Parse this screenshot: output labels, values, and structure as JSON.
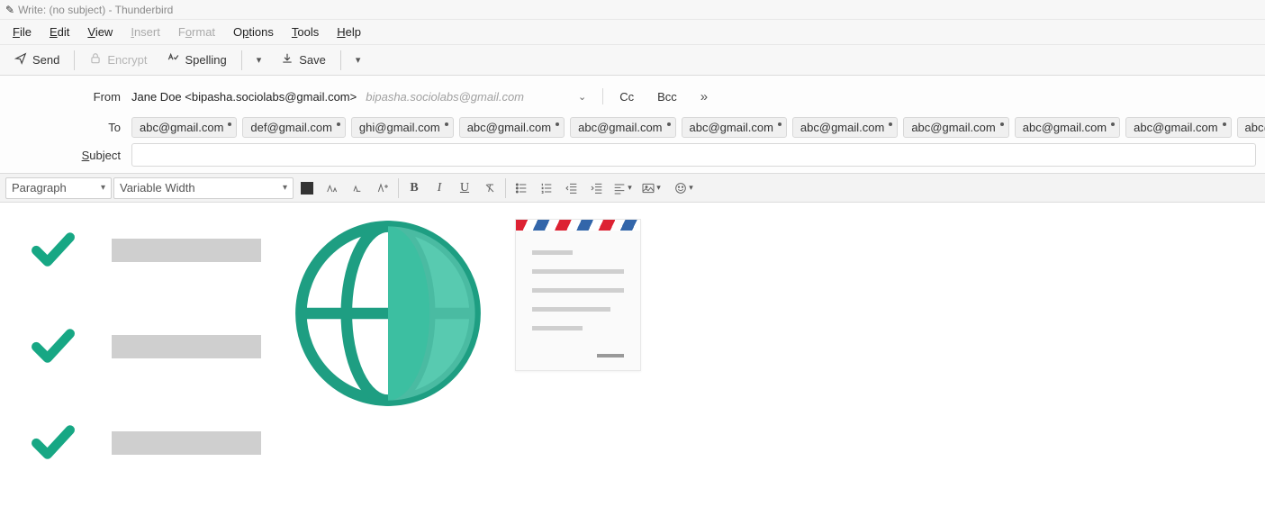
{
  "title": "Write: (no subject) - Thunderbird",
  "menu": {
    "file": "File",
    "edit": "Edit",
    "view": "View",
    "insert": "Insert",
    "format": "Format",
    "options": "Options",
    "tools": "Tools",
    "help": "Help"
  },
  "toolbar": {
    "send": "Send",
    "encrypt": "Encrypt",
    "spelling": "Spelling",
    "save": "Save"
  },
  "header": {
    "from_label": "From",
    "from_name": "Jane Doe <bipasha.sociolabs@gmail.com>",
    "from_account": "bipasha.sociolabs@gmail.com",
    "cc": "Cc",
    "bcc": "Bcc",
    "to_label": "To",
    "subject_label": "Subject",
    "subject_value": ""
  },
  "to_pills": [
    "abc@gmail.com",
    "def@gmail.com",
    "ghi@gmail.com",
    "abc@gmail.com",
    "abc@gmail.com",
    "abc@gmail.com",
    "abc@gmail.com",
    "abc@gmail.com",
    "abc@gmail.com",
    "abc@gmail.com",
    "abc@gmail.com"
  ],
  "format": {
    "block": "Paragraph",
    "font": "Variable Width"
  }
}
